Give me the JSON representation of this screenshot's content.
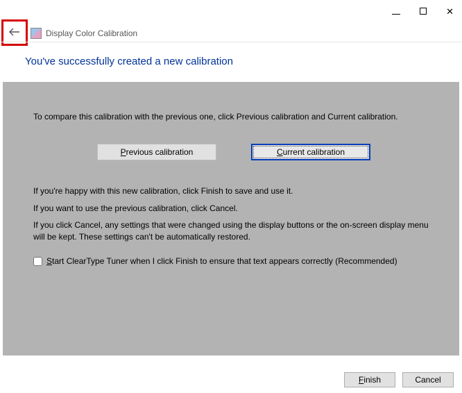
{
  "window": {
    "title": "Display Color Calibration"
  },
  "heading": "You've successfully created a new calibration",
  "panel": {
    "intro": "To compare this calibration with the previous one, click Previous calibration and Current calibration.",
    "prev_btn_pre": "P",
    "prev_btn_post": "revious calibration",
    "curr_btn_pre": "C",
    "curr_btn_post": "urrent calibration",
    "line_happy": "If you're happy with this new calibration, click Finish to save and use it.",
    "line_prev": "If you want to use the previous calibration, click Cancel.",
    "line_cancel": "If you click Cancel, any settings that were changed using the display buttons or the on-screen display menu will be kept. These settings can't be automatically restored.",
    "checkbox_pre": "S",
    "checkbox_post": "tart ClearType Tuner when I click Finish to ensure that text appears correctly (Recommended)"
  },
  "footer": {
    "finish_pre": "F",
    "finish_post": "inish",
    "cancel": "Cancel"
  }
}
